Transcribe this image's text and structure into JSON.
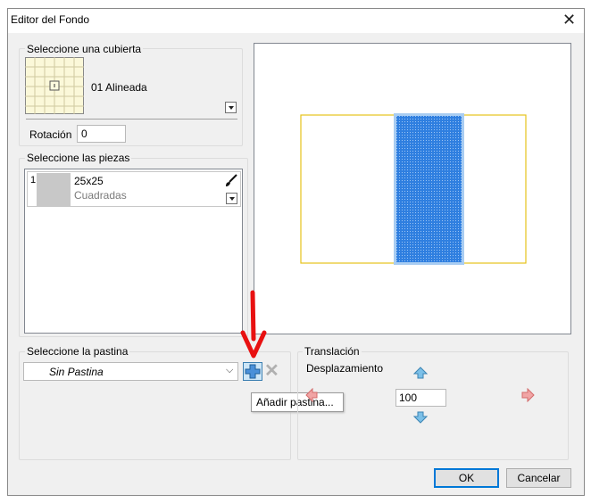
{
  "window": {
    "title": "Editor del Fondo"
  },
  "deck_section": {
    "legend": "Seleccione una cubierta",
    "selected_deck": "01 Alineada",
    "rotation_label": "Rotación",
    "rotation_value": "0"
  },
  "pieces_section": {
    "legend": "Seleccione las piezas",
    "items": [
      {
        "index": "1",
        "name": "25x25",
        "shape": "Cuadradas"
      }
    ]
  },
  "grout_section": {
    "legend": "Seleccione la pastina",
    "selected": "Sin Pastina",
    "tooltip": "Añadir pastina..."
  },
  "translation_section": {
    "legend": "Translación",
    "displacement_label": "Desplazamiento",
    "value": "100"
  },
  "buttons": {
    "ok": "OK",
    "cancel": "Cancelar"
  },
  "colors": {
    "tile_blue": "#2f7fe0",
    "outline_yellow": "#e6c31a",
    "arrow_red": "#e81111"
  }
}
